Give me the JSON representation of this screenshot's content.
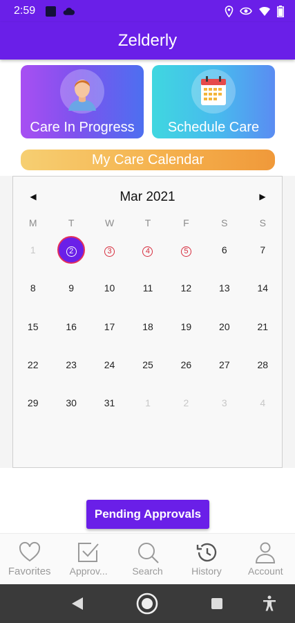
{
  "status_bar": {
    "time": "2:59"
  },
  "header": {
    "title": "Zelderly"
  },
  "cards": {
    "care_in_progress": "Care In Progress",
    "schedule_care": "Schedule Care"
  },
  "calendar_banner": "My Care Calendar",
  "calendar": {
    "title": "Mar 2021",
    "prev": "◀",
    "next": "▶",
    "weekdays": [
      "M",
      "T",
      "W",
      "T",
      "F",
      "S",
      "S"
    ],
    "weeks": [
      [
        "1",
        "2",
        "3",
        "4",
        "5",
        "6",
        "7"
      ],
      [
        "8",
        "9",
        "10",
        "11",
        "12",
        "13",
        "14"
      ],
      [
        "15",
        "16",
        "17",
        "18",
        "19",
        "20",
        "21"
      ],
      [
        "22",
        "23",
        "24",
        "25",
        "26",
        "27",
        "28"
      ],
      [
        "29",
        "30",
        "31",
        "1",
        "2",
        "3",
        "4"
      ]
    ],
    "selected_day": "2",
    "marked_days": [
      "3",
      "4",
      "5"
    ]
  },
  "pending_button": "Pending Approvals",
  "bottom_nav": {
    "favorites": "Favorites",
    "approvals": "Approv...",
    "search": "Search",
    "history": "History",
    "account": "Account"
  },
  "colors": {
    "primary": "#6a1fe8",
    "marked": "#d62b3c",
    "banner": "#f5b24e"
  }
}
